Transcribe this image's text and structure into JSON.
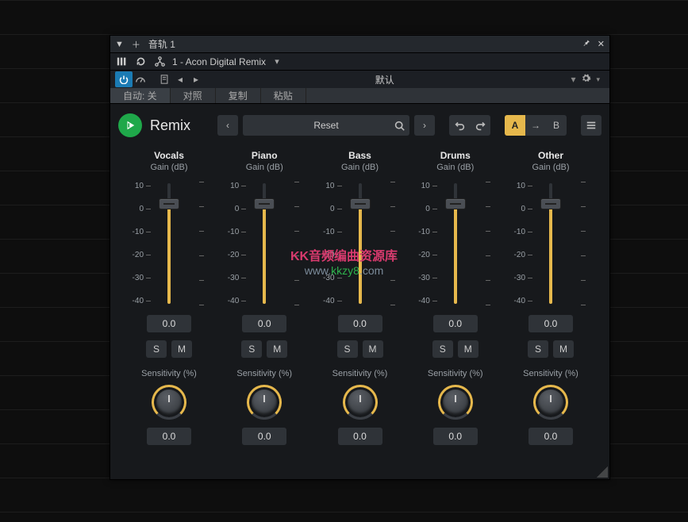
{
  "window": {
    "title": "音轨 1",
    "plugin_selector": "1 - Acon Digital Remix",
    "preset_default": "默认",
    "tabs": {
      "auto": "自动: 关",
      "compare": "对照",
      "copy": "复制",
      "paste": "粘贴"
    }
  },
  "plugin": {
    "title": "Remix",
    "preset": "Reset",
    "ab": {
      "a": "A",
      "b": "B"
    }
  },
  "scale_labels": [
    "10",
    "0",
    "-10",
    "-20",
    "-30",
    "-40"
  ],
  "channels": [
    {
      "name": "Vocals",
      "sub": "Gain (dB)",
      "gain": "0.0",
      "solo": "S",
      "mute": "M",
      "sens_label": "Sensitivity (%)",
      "sens_value": "0.0"
    },
    {
      "name": "Piano",
      "sub": "Gain (dB)",
      "gain": "0.0",
      "solo": "S",
      "mute": "M",
      "sens_label": "Sensitivity (%)",
      "sens_value": "0.0"
    },
    {
      "name": "Bass",
      "sub": "Gain (dB)",
      "gain": "0.0",
      "solo": "S",
      "mute": "M",
      "sens_label": "Sensitivity (%)",
      "sens_value": "0.0"
    },
    {
      "name": "Drums",
      "sub": "Gain (dB)",
      "gain": "0.0",
      "solo": "S",
      "mute": "M",
      "sens_label": "Sensitivity (%)",
      "sens_value": "0.0"
    },
    {
      "name": "Other",
      "sub": "Gain (dB)",
      "gain": "0.0",
      "solo": "S",
      "mute": "M",
      "sens_label": "Sensitivity (%)",
      "sens_value": "0.0"
    }
  ],
  "watermark": {
    "line1": "KK音频编曲资源库",
    "line2_a": "www.",
    "line2_b": "kkzy8",
    "line2_c": ".com"
  }
}
